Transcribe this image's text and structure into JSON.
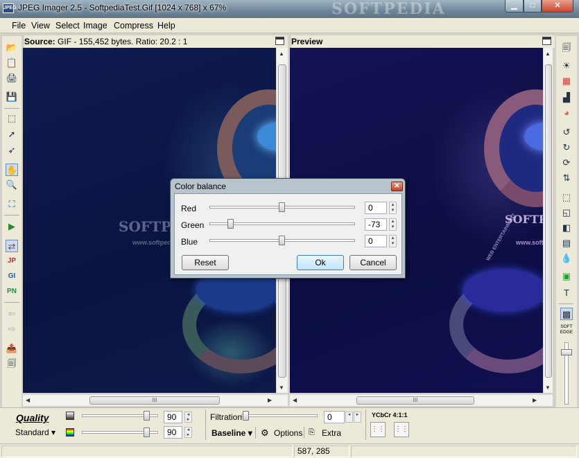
{
  "window": {
    "title": "JPEG Imager 2.5 - SoftpediaTest.Gif [1024 x 768] x 67%",
    "app_icon": "JPEG",
    "watermark": "SOFTPEDIA"
  },
  "menu": [
    "File",
    "View",
    "Select",
    "Image",
    "Compress",
    "Help"
  ],
  "source_pane": {
    "label": "Source:",
    "info": "GIF - 155,452 bytes. Ratio: 20.2 : 1"
  },
  "preview_pane": {
    "label": "Preview"
  },
  "image_overlay": {
    "brand": "SOFTPEDIA",
    "url": "www.softpedia.com",
    "tag": "WEB ENTERTAINMENT"
  },
  "left_toolbar_icons": [
    "open-folder-icon",
    "paste-icon",
    "scan-icon",
    "save-icon",
    "select-rect-icon",
    "select-lasso-icon",
    "select-magic-icon",
    "hand-tool-icon",
    "zoom-icon",
    "fit-window-icon",
    "apply-icon",
    "compare-icon",
    "jpeg-format-icon",
    "gif-format-icon",
    "png-format-icon",
    "back-icon",
    "forward-icon",
    "export-icon",
    "batch-icon"
  ],
  "right_toolbar_icons": [
    "copy-icon",
    "brightness-icon",
    "color-grid-icon",
    "histogram-icon",
    "color-wheel-icon",
    "rotate-left-icon",
    "rotate-right-icon",
    "rotate-icon",
    "flip-icon",
    "crop-icon",
    "resize-icon",
    "mirror-icon",
    "tile-icon",
    "droplet-icon",
    "green-box-icon",
    "text-icon",
    "soft-edge-icon"
  ],
  "soft_edge_label": "SOFT EDGE",
  "bottom": {
    "quality_label": "Quality",
    "mode": "Standard",
    "quality_value_1": "90",
    "quality_value_2": "90",
    "filtration_label": "Filtration",
    "filtration_value": "0",
    "baseline_label": "Baseline",
    "options_label": "Options",
    "extra_label": "Extra",
    "subsampling": "YCbCr 4:1:1"
  },
  "status": {
    "coords": "587, 285"
  },
  "dialog": {
    "title": "Color balance",
    "rows": [
      {
        "label": "Red",
        "value": "0"
      },
      {
        "label": "Green",
        "value": "-73"
      },
      {
        "label": "Blue",
        "value": "0"
      }
    ],
    "reset": "Reset",
    "ok": "Ok",
    "cancel": "Cancel"
  }
}
